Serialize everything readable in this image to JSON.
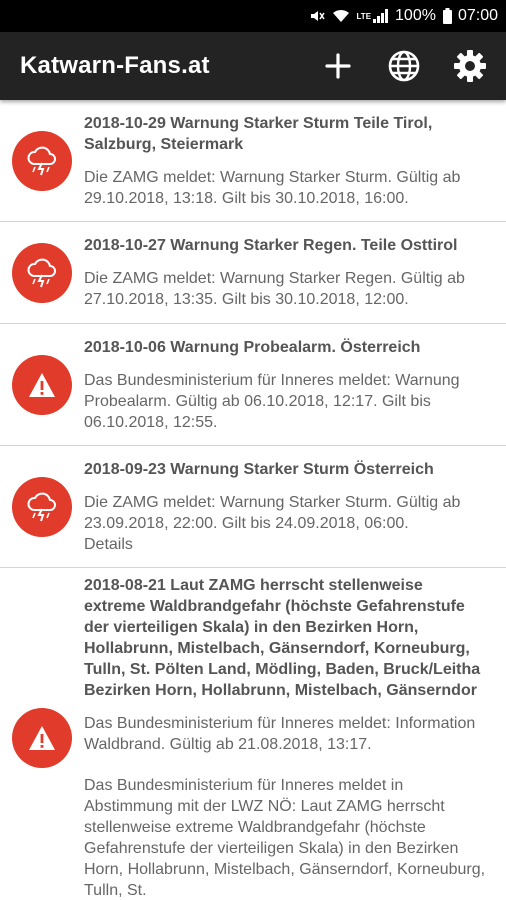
{
  "status": {
    "battery": "100%",
    "time": "07:00",
    "network": "LTE"
  },
  "app": {
    "title": "Katwarn-Fans.at"
  },
  "colors": {
    "alert_red": "#e03b2b",
    "appbar": "#232323"
  },
  "warnings": [
    {
      "icon": "storm-icon",
      "title": "2018-10-29 Warnung Starker Sturm Teile Tirol, Salzburg, Steiermark",
      "body": "Die ZAMG meldet: Warnung Starker Sturm. Gültig ab 29.10.2018, 13:18. Gilt bis 30.10.2018, 16:00."
    },
    {
      "icon": "storm-icon",
      "title": "2018-10-27 Warnung Starker Regen. Teile Osttirol",
      "body": "Die ZAMG meldet: Warnung Starker Regen. Gültig ab 27.10.2018, 13:35. Gilt bis 30.10.2018, 12:00."
    },
    {
      "icon": "warning-triangle-icon",
      "title": "2018-10-06 Warnung Probealarm. Österreich",
      "body": "Das Bundesministerium für Inneres meldet: Warnung Probealarm. Gültig ab 06.10.2018, 12:17. Gilt bis 06.10.2018, 12:55."
    },
    {
      "icon": "storm-icon",
      "title": "2018-09-23 Warnung Starker Sturm Österreich",
      "body": "Die ZAMG meldet: Warnung Starker Sturm. Gültig ab 23.09.2018, 22:00. Gilt bis 24.09.2018, 06:00.",
      "details": "Details"
    },
    {
      "icon": "warning-triangle-icon",
      "title": "2018-08-21 Laut ZAMG herrscht stellenweise extreme Waldbrandgefahr (höchste Gefahrenstufe der vierteiligen Skala) in den Bezirken Horn, Hollabrunn, Mistelbach, Gänserndorf, Korneuburg, Tulln, St. Pölten Land, Mödling, Baden, Bruck/Leitha Bezirken Horn, Hollabrunn, Mistelbach, Gänserndor",
      "body": "Das Bundesministerium für Inneres meldet: Information Waldbrand. Gültig ab 21.08.2018, 13:17.",
      "body2": "Das Bundesministerium für Inneres meldet in Abstimmung mit der LWZ NÖ: Laut ZAMG herrscht stellenweise extreme Waldbrandgefahr (höchste Gefahrenstufe der vierteiligen Skala) in den Bezirken Horn, Hollabrunn, Mistelbach, Gänserndorf, Korneuburg, Tulln, St."
    }
  ]
}
